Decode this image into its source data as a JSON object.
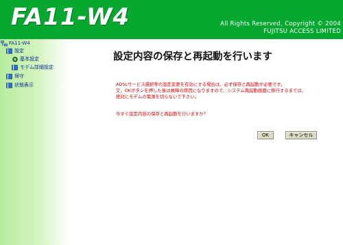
{
  "header": {
    "logo": "FA11-W4",
    "copyright_line1": "All Rights Reserved, Copyright © 2004",
    "copyright_line2": "FUJITSU ACCESS LIMITED"
  },
  "sidebar": {
    "root": {
      "label": "FA11-W4",
      "icon": "network-icon"
    },
    "items": [
      {
        "label": "設定",
        "icon": "book-icon"
      },
      {
        "label": "基本設定",
        "icon": "gear-icon"
      },
      {
        "label": "モデム詳細設定",
        "icon": "book-icon"
      },
      {
        "label": "保守",
        "icon": "book-icon"
      },
      {
        "label": "状態表示",
        "icon": "book-icon"
      }
    ]
  },
  "main": {
    "title": "設定内容の保存と再起動を行います",
    "message_lines": [
      "ADSLサービス選択等の設定変更を有効にする場合は、必ず保存と再起動が必要です。",
      "又、OKボタンを押した後は故障の原因になりますので、システム再起動画面に移行するまでは、",
      "絶対にモデムの電源を切らないで下さい。"
    ],
    "question": "今すぐ設定内容の保存と再起動を行いますか？",
    "ok_label": "OK",
    "cancel_label": "キャンセル"
  },
  "colors": {
    "header_bg": "#06a830",
    "sidebar_bg": "#c6f0ae",
    "message_red": "#e00000",
    "link_blue": "#0a2d99"
  }
}
